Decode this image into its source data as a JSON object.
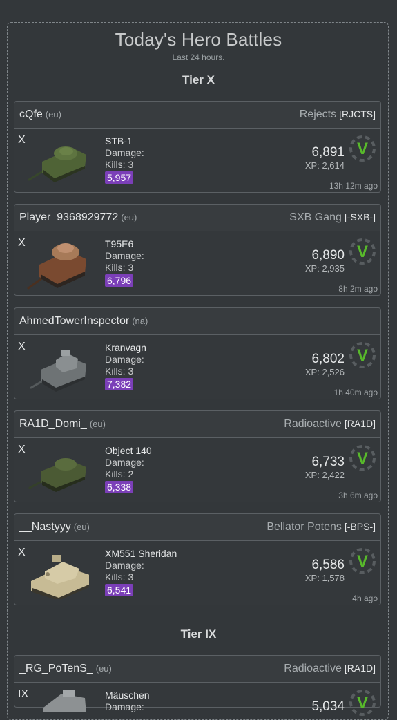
{
  "header": {
    "title": "Today's Hero Battles",
    "subtitle": "Last 24 hours."
  },
  "tiers": [
    {
      "label": "Tier X",
      "battles": [
        {
          "player": "cQfe",
          "region": "(eu)",
          "clan_name": "Rejects",
          "clan_tag": "[RJCTS]",
          "tier": "X",
          "tank": "STB-1",
          "damage_label": "Damage:",
          "kills": "Kills: 3",
          "badge": "5,957",
          "damage": "6,891",
          "xp": "XP: 2,614",
          "ago": "13h 12m ago",
          "result": "V"
        },
        {
          "player": "Player_9368929772",
          "region": "(eu)",
          "clan_name": "SXB Gang",
          "clan_tag": "[-SXB-]",
          "tier": "X",
          "tank": "T95E6",
          "damage_label": "Damage:",
          "kills": "Kills: 3",
          "badge": "6,796",
          "damage": "6,890",
          "xp": "XP: 2,935",
          "ago": "8h 2m ago",
          "result": "V"
        },
        {
          "player": "AhmedTowerInspector",
          "region": "(na)",
          "clan_name": "",
          "clan_tag": "",
          "tier": "X",
          "tank": "Kranvagn",
          "damage_label": "Damage:",
          "kills": "Kills: 3",
          "badge": "7,382",
          "damage": "6,802",
          "xp": "XP: 2,526",
          "ago": "1h 40m ago",
          "result": "V"
        },
        {
          "player": "RA1D_Domi_",
          "region": "(eu)",
          "clan_name": "Radioactive",
          "clan_tag": "[RA1D]",
          "tier": "X",
          "tank": "Object 140",
          "damage_label": "Damage:",
          "kills": "Kills: 2",
          "badge": "6,338",
          "damage": "6,733",
          "xp": "XP: 2,422",
          "ago": "3h 6m ago",
          "result": "V"
        },
        {
          "player": "__Nastyyy",
          "region": "(eu)",
          "clan_name": "Bellator Potens",
          "clan_tag": "[-BPS-]",
          "tier": "X",
          "tank": "XM551 Sheridan",
          "damage_label": "Damage:",
          "kills": "Kills: 3",
          "badge": "6,541",
          "damage": "6,586",
          "xp": "XP: 1,578",
          "ago": "4h ago",
          "result": "V"
        }
      ]
    },
    {
      "label": "Tier IX",
      "battles": [
        {
          "player": "_RG_PoTenS_",
          "region": "(eu)",
          "clan_name": "Radioactive",
          "clan_tag": "[RA1D]",
          "tier": "IX",
          "tank": "Mäuschen",
          "damage_label": "Damage:",
          "kills": "",
          "badge": "",
          "damage": "5,034",
          "xp": "",
          "ago": "",
          "result": "V"
        }
      ]
    }
  ],
  "colors": {
    "background": "#33373a",
    "badge": "#7b3fb8",
    "victory": "#58b92b"
  },
  "icons": [
    "tank-icon",
    "victory-icon"
  ]
}
